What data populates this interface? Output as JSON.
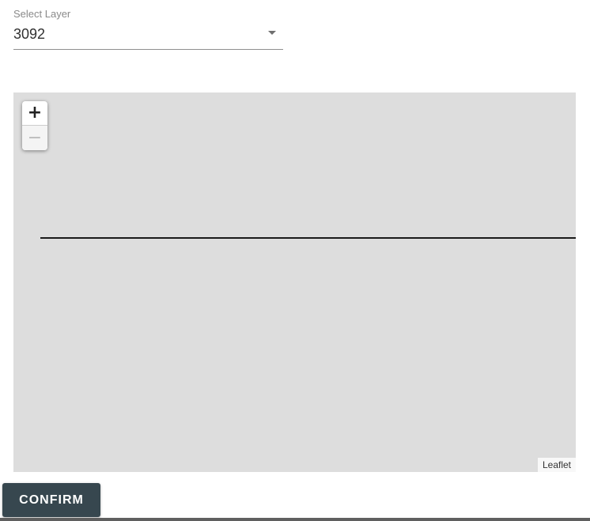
{
  "layer_select": {
    "label": "Select Layer",
    "value": "3092",
    "arrow_icon": "dropdown-arrow-icon"
  },
  "map": {
    "zoom_in_label": "+",
    "zoom_out_label": "−",
    "attribution": "Leaflet",
    "background_color": "#dddddd",
    "line_color": "#1a1a1a"
  },
  "actions": {
    "confirm_label": "CONFIRM",
    "confirm_color": "#37474f"
  }
}
